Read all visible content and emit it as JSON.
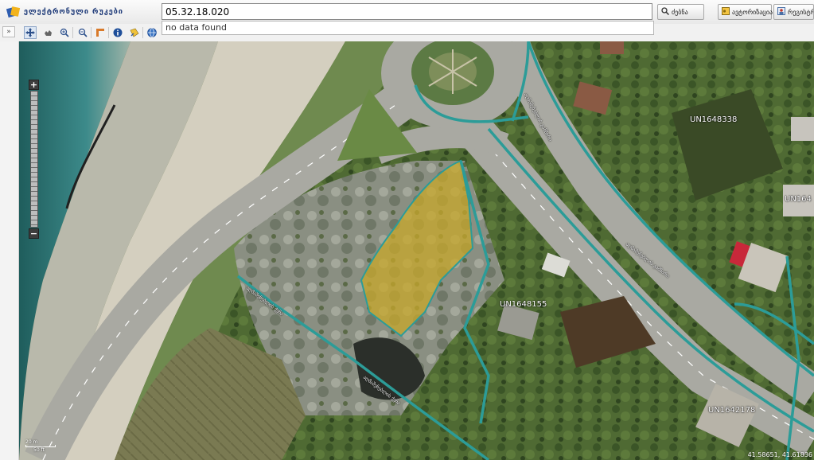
{
  "header": {
    "app_title": "ელექტრონული რუკები",
    "search_value": "05.32.18.020",
    "suggestion": "no data found",
    "search_button_label": "ძებნა",
    "button_2_label": "ავტორიზაცია",
    "button_3_label": "რეგისტრ"
  },
  "toolbar": {
    "collapse_glyph": "»",
    "tools": [
      "pan-icon",
      "hand-icon",
      "zoom-in-icon",
      "zoom-out-icon",
      "measure-icon",
      "info-icon",
      "highlight-icon",
      "globe-icon"
    ]
  },
  "map": {
    "zoom_in": "+",
    "zoom_out": "−",
    "parcel_labels": [
      "UN1648338",
      "UN164",
      "UN1648155",
      "UN1642178"
    ],
    "street_labels": [
      "აღმაშენებლის ქუჩა",
      "აღმაშენებლის გამზირი",
      "აღმაშენებლის გამზირი",
      "აღმაშენებლის ქუჩა"
    ],
    "scale_top": "20 m",
    "scale_bottom": "50 ft",
    "coordinates": "41.58651, 41.61836",
    "colors": {
      "highlight_parcel": "#c8a82a",
      "boundary": "#2c9c98"
    }
  }
}
